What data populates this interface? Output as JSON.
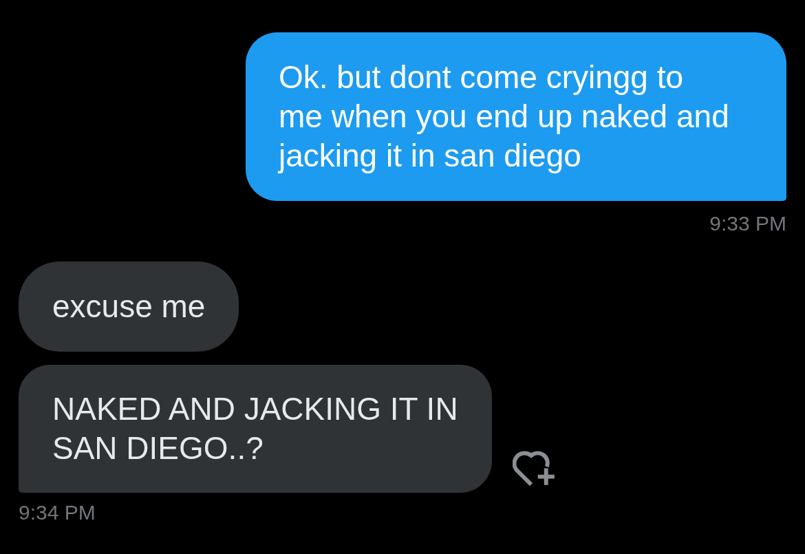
{
  "groups": [
    {
      "kind": "sent",
      "messages": [
        {
          "text": "Ok. but dont come cryingg to\nme when you end up naked and\njacking it in san diego",
          "add_reaction": false
        }
      ],
      "time": "9:33 PM"
    },
    {
      "kind": "received",
      "messages": [
        {
          "text": "excuse me",
          "add_reaction": false
        },
        {
          "text": "NAKED AND JACKING IT IN\nSAN DIEGO..?",
          "add_reaction": true
        }
      ],
      "time": "9:34 PM"
    }
  ]
}
